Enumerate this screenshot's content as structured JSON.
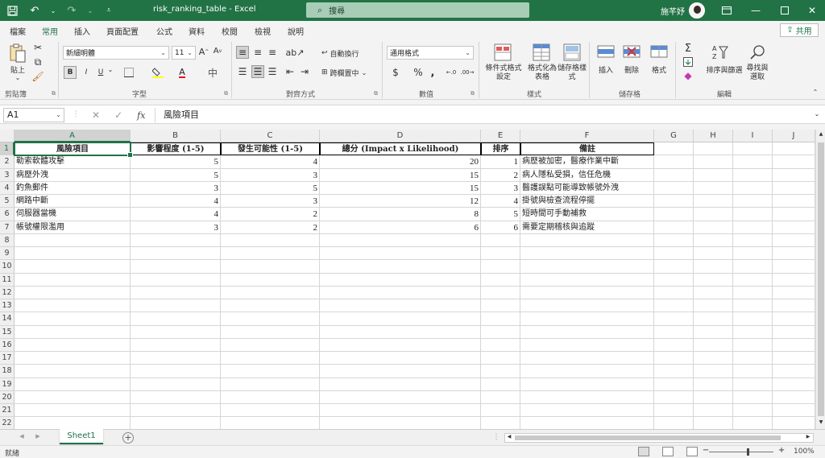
{
  "app": {
    "file_title": "risk_ranking_table - Excel",
    "search_placeholder": "搜尋",
    "user_name": "施芊妤",
    "share_label": "共用"
  },
  "tabs": [
    "檔案",
    "常用",
    "插入",
    "頁面配置",
    "公式",
    "資料",
    "校閱",
    "檢視",
    "說明"
  ],
  "ribbon": {
    "clipboard_label": "剪貼簿",
    "paste_label": "貼上",
    "font_label": "字型",
    "font_name": "新細明體",
    "font_size": "11",
    "bold": "B",
    "italic": "I",
    "underline": "U",
    "alignment_label": "對齊方式",
    "wrap_text": "自動換行",
    "merge_center": "跨欄置中",
    "number_label": "數值",
    "number_format": "通用格式",
    "styles_label": "樣式",
    "conditional_format": "條件式格式設定",
    "format_as_table": "格式化為表格",
    "cell_styles": "儲存格樣式",
    "cells_label": "儲存格",
    "insert": "插入",
    "delete": "刪除",
    "format": "格式",
    "editing_label": "編輯",
    "sort_filter": "排序與篩選",
    "find_select": "尋找與選取"
  },
  "formula_bar": {
    "name_box": "A1",
    "formula": "風險項目"
  },
  "columns": [
    "A",
    "B",
    "C",
    "D",
    "E",
    "F",
    "G",
    "H",
    "I",
    "J"
  ],
  "rows": [
    "1",
    "2",
    "3",
    "4",
    "5",
    "6",
    "7",
    "8",
    "9",
    "10",
    "11",
    "12",
    "13",
    "14",
    "15",
    "16",
    "17",
    "18",
    "19",
    "20",
    "21",
    "22"
  ],
  "table": {
    "headers": [
      "風險項目",
      "影響程度 (1-5)",
      "發生可能性 (1-5)",
      "總分 (Impact x Likelihood)",
      "排序",
      "備註"
    ],
    "rows": [
      [
        "勒索軟體攻擊",
        "5",
        "4",
        "20",
        "1",
        "病歷被加密，醫療作業中斷"
      ],
      [
        "病歷外洩",
        "5",
        "3",
        "15",
        "2",
        "病人隱私受損，信任危機"
      ],
      [
        "釣魚郵件",
        "3",
        "5",
        "15",
        "3",
        "醫護誤點可能導致帳號外洩"
      ],
      [
        "網路中斷",
        "4",
        "3",
        "12",
        "4",
        "掛號與檢查流程停擺"
      ],
      [
        "伺服器當機",
        "4",
        "2",
        "8",
        "5",
        "短時間可手動補救"
      ],
      [
        "帳號權限濫用",
        "3",
        "2",
        "6",
        "6",
        "需要定期稽核與追蹤"
      ]
    ]
  },
  "sheet": {
    "tab_name": "Sheet1"
  },
  "status": {
    "mode": "就緒",
    "zoom": "100%"
  },
  "colors": {
    "accent": "#217346"
  }
}
